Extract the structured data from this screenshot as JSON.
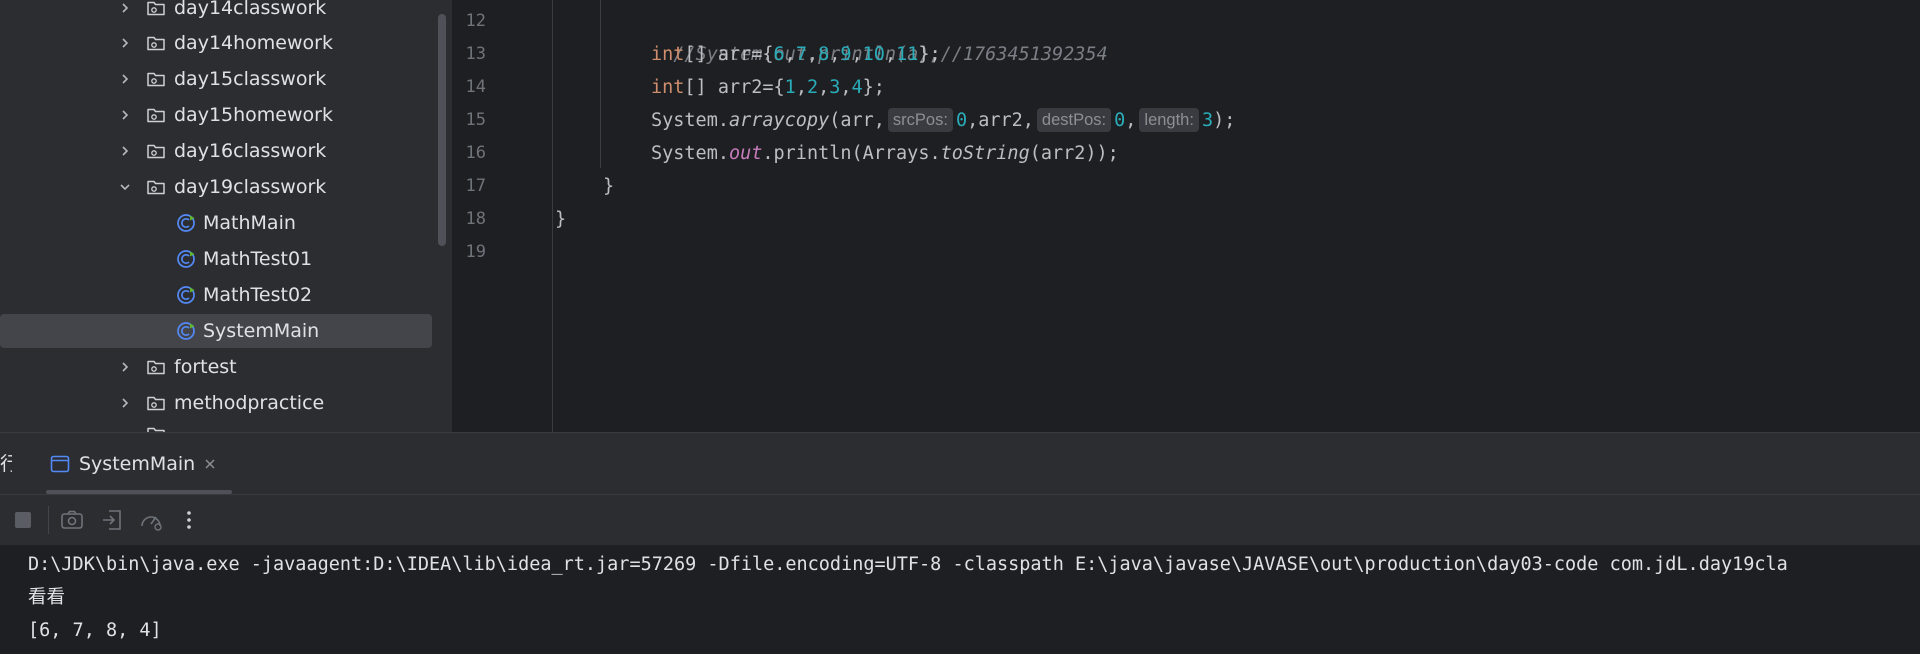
{
  "project_tree": {
    "items": [
      {
        "label": "day14classwork",
        "type": "folder",
        "expanded": false
      },
      {
        "label": "day14homework",
        "type": "folder",
        "expanded": false
      },
      {
        "label": "day15classwork",
        "type": "folder",
        "expanded": false
      },
      {
        "label": "day15homework",
        "type": "folder",
        "expanded": false
      },
      {
        "label": "day16classwork",
        "type": "folder",
        "expanded": false
      },
      {
        "label": "day19classwork",
        "type": "folder",
        "expanded": true
      },
      {
        "label": "MathMain",
        "type": "class"
      },
      {
        "label": "MathTest01",
        "type": "class"
      },
      {
        "label": "MathTest02",
        "type": "class"
      },
      {
        "label": "SystemMain",
        "type": "class",
        "selected": true
      },
      {
        "label": "fortest",
        "type": "folder",
        "expanded": false
      },
      {
        "label": "methodpractice",
        "type": "folder",
        "expanded": false
      }
    ]
  },
  "editor": {
    "line_numbers": [
      "12",
      "13",
      "14",
      "15",
      "16",
      "17",
      "18",
      "19"
    ],
    "line12_comment": "//System.out.println(a);//1763451392354",
    "line13": {
      "type": "int",
      "brackets": "[] arr={",
      "values": [
        "6",
        "7",
        "8",
        "9",
        "10",
        "11"
      ],
      "close": "};"
    },
    "line14": {
      "type": "int",
      "brackets": "[] arr2={",
      "values": [
        "1",
        "2",
        "3",
        "4"
      ],
      "close": "};"
    },
    "line15": {
      "prefix": "System.",
      "method": "arraycopy",
      "open": "(arr,",
      "hint_src": "srcPos:",
      "src_val": "0",
      "mid": ",arr2,",
      "hint_dest": "destPos:",
      "dest_val": "0",
      "comma": ",",
      "hint_len": "length:",
      "len_val": "3",
      "close": ");"
    },
    "line16": {
      "prefix": "System.",
      "field": "out",
      "call": ".println(Arrays.",
      "method": "toString",
      "args": "(arr2));"
    },
    "line17": "}",
    "line18": "}"
  },
  "run_panel": {
    "tool_window_label": "行",
    "tab_label": "SystemMain",
    "console_lines": [
      "D:\\JDK\\bin\\java.exe -javaagent:D:\\IDEA\\lib\\idea_rt.jar=57269 -Dfile.encoding=UTF-8 -classpath E:\\java\\javase\\JAVASE\\out\\production\\day03-code com.jdL.day19cla",
      "看看",
      "[6, 7, 8, 4]"
    ]
  },
  "colors": {
    "keyword": "#cf8e6d",
    "number": "#2aacb8",
    "comment": "#7a7e85",
    "method": "#56a8f5",
    "field": "#c77dbb",
    "selection": "#43454a"
  }
}
